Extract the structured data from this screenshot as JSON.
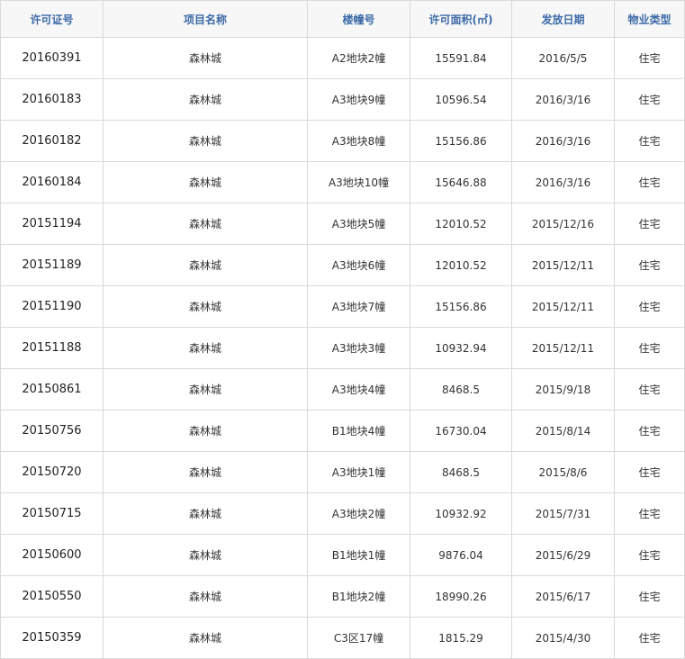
{
  "table": {
    "headers": [
      "许可证号",
      "项目名称",
      "楼幢号",
      "许可面积(㎡)",
      "发放日期",
      "物业类型"
    ],
    "rows": [
      [
        "20160391",
        "森林城",
        "A2地块2幢",
        "15591.84",
        "2016/5/5",
        "住宅"
      ],
      [
        "20160183",
        "森林城",
        "A3地块9幢",
        "10596.54",
        "2016/3/16",
        "住宅"
      ],
      [
        "20160182",
        "森林城",
        "A3地块8幢",
        "15156.86",
        "2016/3/16",
        "住宅"
      ],
      [
        "20160184",
        "森林城",
        "A3地块10幢",
        "15646.88",
        "2016/3/16",
        "住宅"
      ],
      [
        "20151194",
        "森林城",
        "A3地块5幢",
        "12010.52",
        "2015/12/16",
        "住宅"
      ],
      [
        "20151189",
        "森林城",
        "A3地块6幢",
        "12010.52",
        "2015/12/11",
        "住宅"
      ],
      [
        "20151190",
        "森林城",
        "A3地块7幢",
        "15156.86",
        "2015/12/11",
        "住宅"
      ],
      [
        "20151188",
        "森林城",
        "A3地块3幢",
        "10932.94",
        "2015/12/11",
        "住宅"
      ],
      [
        "20150861",
        "森林城",
        "A3地块4幢",
        "8468.5",
        "2015/9/18",
        "住宅"
      ],
      [
        "20150756",
        "森林城",
        "B1地块4幢",
        "16730.04",
        "2015/8/14",
        "住宅"
      ],
      [
        "20150720",
        "森林城",
        "A3地块1幢",
        "8468.5",
        "2015/8/6",
        "住宅"
      ],
      [
        "20150715",
        "森林城",
        "A3地块2幢",
        "10932.92",
        "2015/7/31",
        "住宅"
      ],
      [
        "20150600",
        "森林城",
        "B1地块1幢",
        "9876.04",
        "2015/6/29",
        "住宅"
      ],
      [
        "20150550",
        "森林城",
        "B1地块2幢",
        "18990.26",
        "2015/6/17",
        "住宅"
      ],
      [
        "20150359",
        "森林城",
        "C3区17幢",
        "1815.29",
        "2015/4/30",
        "住宅"
      ]
    ]
  }
}
